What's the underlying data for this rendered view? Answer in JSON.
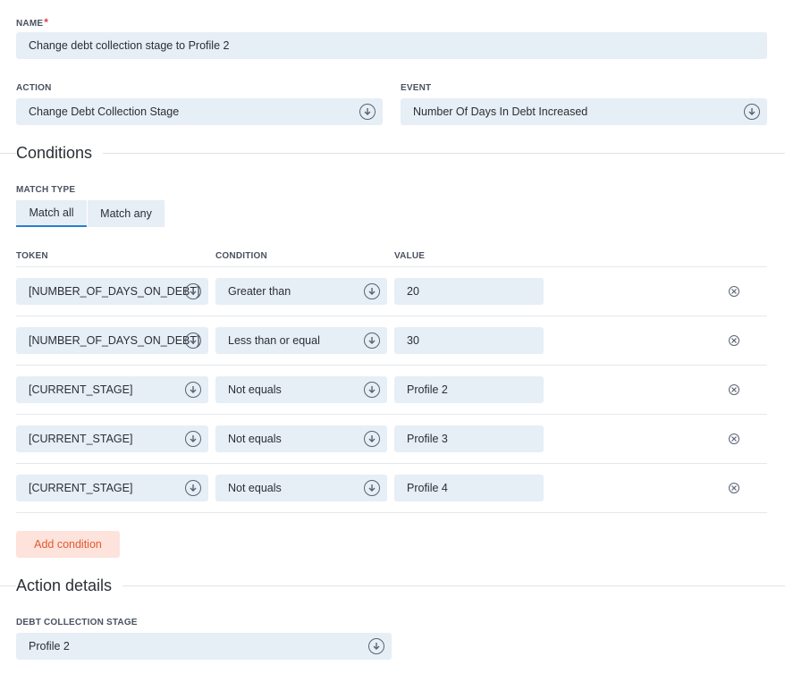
{
  "name": {
    "label": "NAME",
    "required_mark": "*",
    "value": "Change debt collection stage to Profile 2"
  },
  "action": {
    "label": "ACTION",
    "value": "Change Debt Collection Stage"
  },
  "event": {
    "label": "EVENT",
    "value": "Number Of Days In Debt Increased"
  },
  "conditions": {
    "title": "Conditions",
    "match_type_label": "MATCH TYPE",
    "match_all": "Match all",
    "match_any": "Match any",
    "selected_match": "Match all",
    "columns": {
      "token": "TOKEN",
      "condition": "CONDITION",
      "value": "VALUE"
    },
    "rows": [
      {
        "token": "[NUMBER_OF_DAYS_ON_DEBT]",
        "condition": "Greater than",
        "value": "20"
      },
      {
        "token": "[NUMBER_OF_DAYS_ON_DEBT]",
        "condition": "Less than or equal",
        "value": "30"
      },
      {
        "token": "[CURRENT_STAGE]",
        "condition": "Not equals",
        "value": "Profile 2"
      },
      {
        "token": "[CURRENT_STAGE]",
        "condition": "Not equals",
        "value": "Profile 3"
      },
      {
        "token": "[CURRENT_STAGE]",
        "condition": "Not equals",
        "value": "Profile 4"
      }
    ],
    "add_label": "Add condition"
  },
  "action_details": {
    "title": "Action details",
    "stage_label": "DEBT COLLECTION STAGE",
    "stage_value": "Profile 2"
  },
  "icons": {
    "dropdown": "arrow-down-circle-icon",
    "remove": "close-circle-icon"
  },
  "colors": {
    "field_bg": "#e6eef6",
    "accent": "#2b7bd1",
    "add_bg": "#fde3dc",
    "add_text": "#e2592f",
    "required": "#d64545"
  }
}
